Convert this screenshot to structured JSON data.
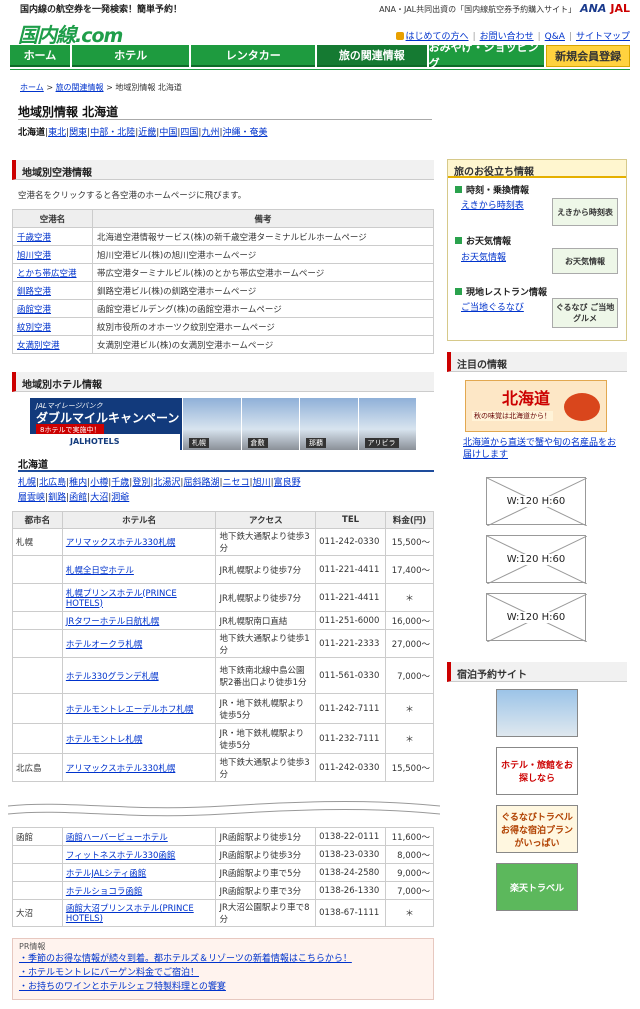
{
  "header": {
    "tagline": "国内線の航空券を一発検索！簡単予約！",
    "sub": "ANA・JAL共同出資の「国内線航空券予約購入サイト」",
    "ana": "ANA",
    "jal": "JAL",
    "logo_main": "国内線",
    "logo_dot": ".com",
    "links": [
      "はじめての方へ",
      "お問い合わせ",
      "Q&A",
      "サイトマップ"
    ]
  },
  "nav": [
    "ホーム",
    "ホテル",
    "レンタカー",
    "旅の関連情報",
    "おみやげ・ショッピング",
    "新規会員登録"
  ],
  "breadcrumb": {
    "home": "ホーム",
    "sep": ">",
    "rel": "旅の関連情報",
    "current": "> 地域別情報 北海道"
  },
  "page_title": "地域別情報 北海道",
  "regions": [
    "北海道",
    "東北",
    "関東",
    "中部・北陸",
    "近畿",
    "中国",
    "四国",
    "九州",
    "沖縄・奄美"
  ],
  "airport": {
    "heading": "地域別空港情報",
    "desc": "空港名をクリックすると各空港のホームページに飛びます。",
    "col_name": "空港名",
    "col_note": "備考",
    "rows": [
      [
        "千歳空港",
        "北海道空港情報サービス(株)の新千歳空港ターミナルビルホームページ"
      ],
      [
        "旭川空港",
        "旭川空港ビル(株)の旭川空港ホームページ"
      ],
      [
        "とかち帯広空港",
        "帯広空港ターミナルビル(株)のとかち帯広空港ホームページ"
      ],
      [
        "釧路空港",
        "釧路空港ビル(株)の釧路空港ホームページ"
      ],
      [
        "函館空港",
        "函館空港ビルデング(株)の函館空港ホームページ"
      ],
      [
        "紋別空港",
        "紋別市役所のオホーツク紋別空港ホームページ"
      ],
      [
        "女満別空港",
        "女満別空港ビル(株)の女満別空港ホームページ"
      ]
    ]
  },
  "hotel": {
    "heading": "地域別ホテル情報",
    "banner": {
      "small": "JALマイレージバンク",
      "main": "ダブルマイルキャンペーン",
      "tag": "8ホテルで実施中！",
      "brand": "JALHOTELS",
      "places": [
        "札幌",
        "倉敷",
        "那覇",
        "アリビラ"
      ]
    },
    "area_title": "北海道",
    "areas": [
      "札幌",
      "北広島",
      "稚内",
      "小樽",
      "千歳",
      "登別",
      "北湯沢",
      "屈斜路湖",
      "ニセコ",
      "旭川",
      "富良野",
      "層雲峡",
      "釧路",
      "函館",
      "大沼",
      "洞爺"
    ],
    "cols": [
      "都市名",
      "ホテル名",
      "アクセス",
      "TEL",
      "料金(円)"
    ],
    "rows": [
      [
        "札幌",
        "アリマックスホテル330札幌",
        "地下鉄大通駅より徒歩3分",
        "011-242-0330",
        "15,500〜"
      ],
      [
        "",
        "札幌全日空ホテル",
        "JR札幌駅より徒歩7分",
        "011-221-4411",
        "17,400〜"
      ],
      [
        "",
        "札幌プリンスホテル(PRINCE HOTELS)",
        "JR札幌駅より徒歩7分",
        "011-221-4411",
        "＊"
      ],
      [
        "",
        "JRタワーホテル日航札幌",
        "JR札幌駅南口直結",
        "011-251-6000",
        "16,000〜"
      ],
      [
        "",
        "ホテルオークラ札幌",
        "地下鉄大通駅より徒歩1分",
        "011-221-2333",
        "27,000〜"
      ],
      [
        "",
        "ホテル330グランデ札幌",
        "地下鉄南北線中島公園駅2番出口より徒歩1分",
        "011-561-0330",
        "7,000〜"
      ],
      [
        "",
        "ホテルモントレエーデルホフ札幌",
        "JR・地下鉄札幌駅より徒歩5分",
        "011-242-7111",
        "＊"
      ],
      [
        "",
        "ホテルモントレ札幌",
        "JR・地下鉄札幌駅より徒歩5分",
        "011-232-7111",
        "＊"
      ],
      [
        "北広島",
        "アリマックスホテル330札幌",
        "地下鉄大通駅より徒歩3分",
        "011-242-0330",
        "15,500〜"
      ]
    ],
    "rows2": [
      [
        "函館",
        "函館ハーバービューホテル",
        "JR函館駅より徒歩1分",
        "0138-22-0111",
        "11,600〜"
      ],
      [
        "",
        "フィットネスホテル330函館",
        "JR函館駅より徒歩3分",
        "0138-23-0330",
        "8,000〜"
      ],
      [
        "",
        "ホテルJALシティ函館",
        "JR函館駅より車で5分",
        "0138-24-2580",
        "9,000〜"
      ],
      [
        "",
        "ホテルショコラ函館",
        "JR函館駅より車で3分",
        "0138-26-1330",
        "7,000〜"
      ],
      [
        "大沼",
        "函館大沼プリンスホテル(PRINCE HOTELS)",
        "JR大沼公園駅より車で8分",
        "0138-67-1111",
        "＊"
      ]
    ]
  },
  "pr": {
    "label": "PR情報",
    "items": [
      "・季節のお得な情報が続々到着。都ホテルズ＆リゾーツの新着情報はこちらから！",
      "・ホテルモントレにバーゲン料金でご宿泊！",
      "・お持ちのワインとホテルシェフ特製料理との饗宴"
    ]
  },
  "side": {
    "useful": "旅のお役立ち情報",
    "time": "時刻・乗換情報",
    "time_link": "えきから時刻表",
    "time_img": "えきから時刻表",
    "weather": "お天気情報",
    "weather_link": "お天気情報",
    "weather_img": "お天気情報",
    "rest": "現地レストラン情報",
    "rest_link": "ご当地ぐるなび",
    "rest_img": "ぐるなび ご当地グルメ",
    "attn": "注目の情報",
    "hk_banner": "北海道",
    "hk_banner_sub": "秋の味覚は北海道から！",
    "hk_link": "北海道から直送で蟹や旬の名産品をお届けします",
    "ph": [
      "W:120 H:60",
      "W:120 H:60",
      "W:120 H:60"
    ],
    "lodging": "宿泊予約サイト",
    "sites": [
      "ホテル・旅館をお探しなら",
      "ぐるなびトラベル お得な宿泊プランがいっぱい",
      "楽天トラベル"
    ]
  },
  "colors": {
    "green": "#1e9b3f",
    "accent_red": "#cc0000",
    "link": "#0033cc"
  }
}
